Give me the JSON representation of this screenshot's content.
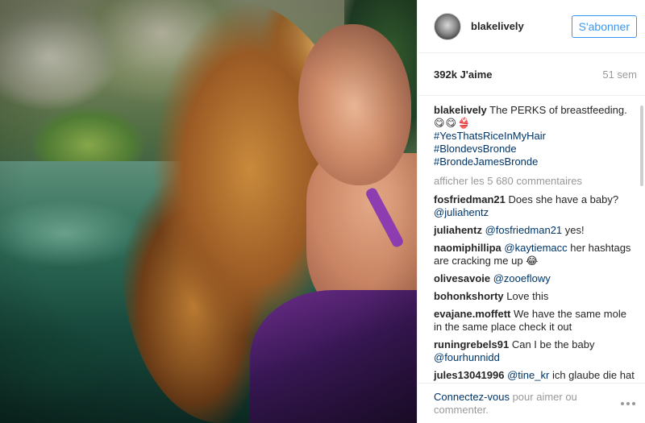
{
  "header": {
    "username": "blakelively",
    "follow_label": "S'abonner"
  },
  "stats": {
    "likes": "392k J'aime",
    "age": "51 sem"
  },
  "caption": {
    "username": "blakelively",
    "text": "The PERKS of breastfeeding.",
    "emojis": "😋😋👙",
    "hashtags": [
      "#YesThatsRiceInMyHair",
      "#BlondevsBronde",
      "#BrondeJamesBronde"
    ]
  },
  "more_comments_label": "afficher les 5 680 commentaires",
  "comments": [
    {
      "user": "fosfriedman21",
      "text": "Does she have a baby?",
      "mention": "@juliahentz",
      "after": ""
    },
    {
      "user": "juliahentz",
      "text": "",
      "mention": "@fosfriedman21",
      "after": "yes!"
    },
    {
      "user": "naomiphillipa",
      "text": "",
      "mention": "@kaytiemacc",
      "after": "her hashtags are cracking me up 😂"
    },
    {
      "user": "olivesavoie",
      "text": "",
      "mention": "@zooeflowy",
      "after": ""
    },
    {
      "user": "bohonkshorty",
      "text": "Love this",
      "mention": "",
      "after": ""
    },
    {
      "user": "evajane.moffett",
      "text": "We have the same mole in the same place check it out",
      "mention": "",
      "after": ""
    },
    {
      "user": "runingrebels91",
      "text": "Can I be the baby",
      "mention": "@fourhunnidd",
      "after": ""
    },
    {
      "user": "jules13041996",
      "text": "",
      "mention": "@tine_kr",
      "after": "ich glaube die hat den gleichen Bikini wie ich :D"
    }
  ],
  "footer": {
    "login_link": "Connectez-vous",
    "login_rest": "pour aimer ou commenter."
  },
  "icons": {
    "more": "more-dots-icon"
  }
}
